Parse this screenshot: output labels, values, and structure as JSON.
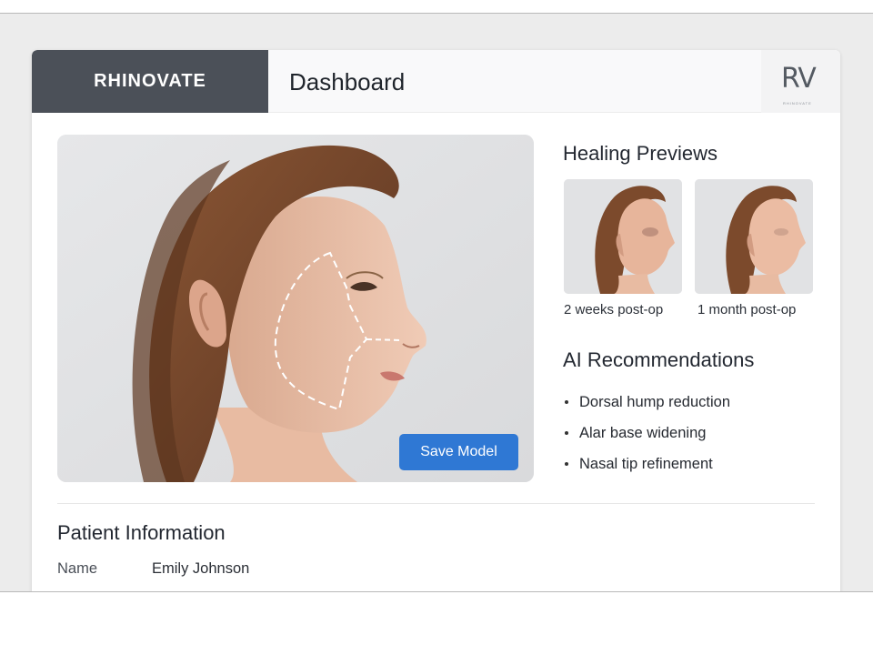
{
  "header": {
    "brand": "RHINOVATE",
    "title": "Dashboard",
    "logo_mark": "RV",
    "logo_sub": "RHINOVATE"
  },
  "main": {
    "save_button": "Save Model"
  },
  "healing_previews": {
    "title": "Healing Previews",
    "items": [
      {
        "caption": "2 weeks post-op"
      },
      {
        "caption": "1 month post-op"
      }
    ]
  },
  "ai_recommendations": {
    "title": "AI Recommendations",
    "items": [
      "Dorsal hump reduction",
      "Alar base widening",
      "Nasal tip refinement"
    ]
  },
  "patient": {
    "title": "Patient Information",
    "name_label": "Name",
    "name_value": "Emily Johnson"
  },
  "colors": {
    "brand_bg": "#4b5058",
    "accent": "#2f78d4"
  }
}
